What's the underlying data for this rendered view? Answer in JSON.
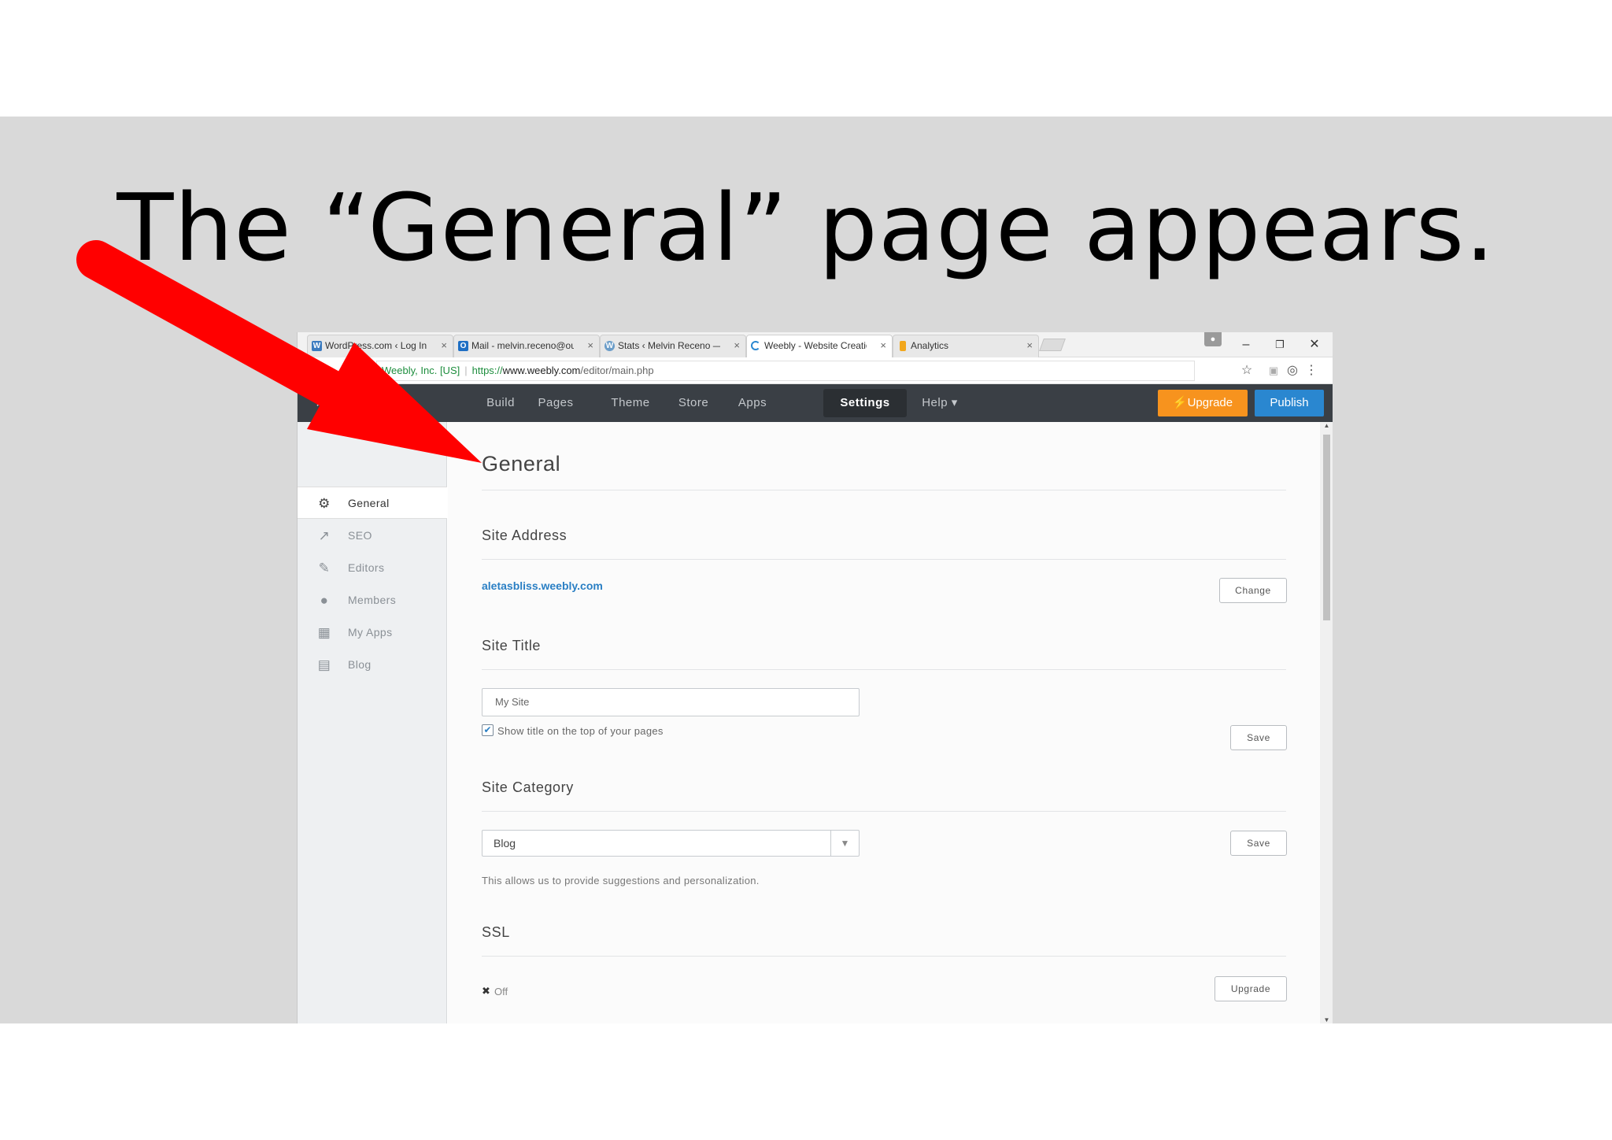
{
  "slide": {
    "title": "The “General” page appears."
  },
  "browser": {
    "tabs": [
      {
        "label": "WordPress.com ‹ Log In",
        "favicon": "wordpress-icon",
        "close": "×"
      },
      {
        "label": "Mail - melvin.receno@ou",
        "favicon": "outlook-icon",
        "close": "×"
      },
      {
        "label": "Stats ‹ Melvin Receno —",
        "favicon": "wordpress-icon",
        "close": "×"
      },
      {
        "label": "Weebly - Website Creatio",
        "favicon": "loading-icon",
        "close": "×"
      },
      {
        "label": "Analytics",
        "favicon": "analytics-icon",
        "close": "×"
      }
    ],
    "url_owner": "Weebly, Inc. [US]",
    "url_scheme": "https://",
    "url_host": "www.weebly.com",
    "url_path": "/editor/main.php"
  },
  "topbar": {
    "close_glyph": "×",
    "nav": [
      "Build",
      "Pages",
      "Theme",
      "Store",
      "Apps",
      "Settings",
      "Help ▾"
    ],
    "active": "Settings",
    "upgrade_label": "⚡Upgrade",
    "publish_label": "Publish",
    "colors": {
      "upgrade": "#f7931e",
      "publish": "#2a87d0",
      "bar": "#3a3f45"
    }
  },
  "sidebar": {
    "items": [
      {
        "label": "General",
        "icon": "gear-icon"
      },
      {
        "label": "SEO",
        "icon": "trend-icon"
      },
      {
        "label": "Editors",
        "icon": "pencil-icon"
      },
      {
        "label": "Members",
        "icon": "user-icon"
      },
      {
        "label": "My Apps",
        "icon": "grid-icon"
      },
      {
        "label": "Blog",
        "icon": "comment-icon"
      }
    ],
    "active": "General"
  },
  "main": {
    "heading": "General",
    "site_address": {
      "title": "Site Address",
      "value": "aletasbliss.weebly.com",
      "button": "Change"
    },
    "site_title": {
      "title": "Site Title",
      "value": "My Site",
      "checkbox_label": "Show title on the top of your pages",
      "checked": true,
      "button": "Save"
    },
    "site_category": {
      "title": "Site Category",
      "value": "Blog",
      "help": "This allows us to provide suggestions and personalization.",
      "button": "Save"
    },
    "ssl": {
      "title": "SSL",
      "status": "Off",
      "button": "Upgrade"
    }
  },
  "annotation": {
    "arrow_color": "#ff0000"
  }
}
